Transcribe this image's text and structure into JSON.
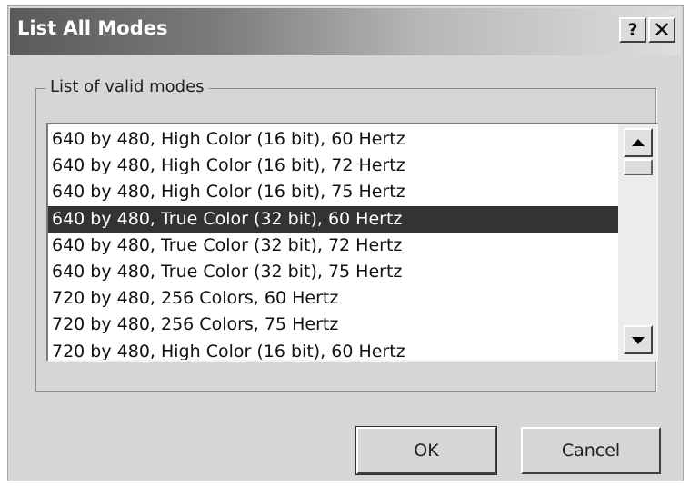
{
  "window": {
    "title": "List All Modes",
    "help_label": "?",
    "close_label": "✕"
  },
  "group": {
    "label": "List of valid modes"
  },
  "modes": [
    "640 by 480, High Color (16 bit), 60 Hertz",
    "640 by 480, High Color (16 bit), 72 Hertz",
    "640 by 480, High Color (16 bit), 75 Hertz",
    "640 by 480, True Color (32 bit), 60 Hertz",
    "640 by 480, True Color (32 bit), 72 Hertz",
    "640 by 480, True Color (32 bit), 75 Hertz",
    "720 by 480, 256 Colors, 60 Hertz",
    "720 by 480, 256 Colors, 75 Hertz",
    "720 by 480, High Color (16 bit), 60 Hertz"
  ],
  "selected_index": 3,
  "scrollbar": {
    "up_icon": "triangle-up-icon",
    "down_icon": "triangle-down-icon"
  },
  "buttons": {
    "ok": "OK",
    "cancel": "Cancel"
  }
}
